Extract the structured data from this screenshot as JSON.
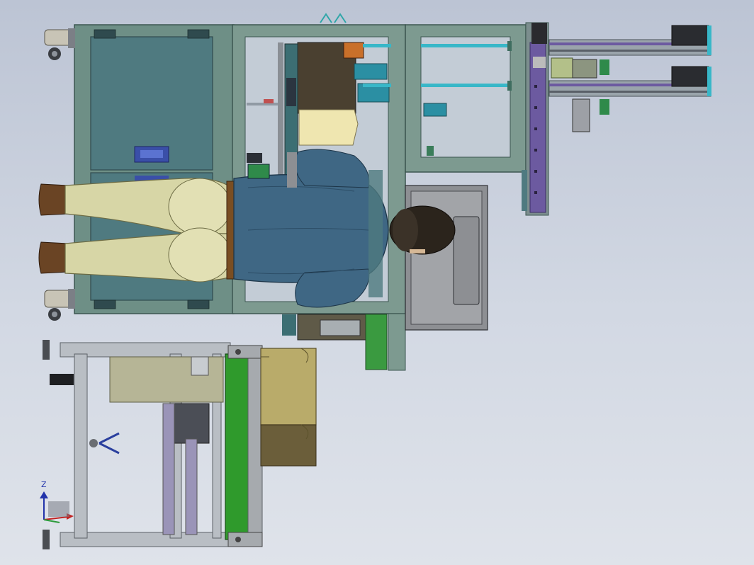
{
  "viewport": {
    "background_top": "#bcc4d4",
    "background_bottom": "#dfe3ea"
  },
  "colors": {
    "frame_teal": "#6e8f86",
    "frame_edge": "#3c5650",
    "panel_teal": "#4f7a80",
    "aluminum": "#b9bec4",
    "conveyor_green": "#2f9a2c",
    "box_tan": "#b9ab6a",
    "shirt_blue": "#3f6784",
    "pants_khaki": "#d7d6a6",
    "hair_dark": "#2b241c",
    "rail_purple": "#6c5aa0",
    "cyan_rod": "#38b7c8",
    "panel_label": "#2a3f9e",
    "machine_gray": "#8d8f93"
  },
  "triad": {
    "axis_label": "Z",
    "icons": [
      "triad-z-arrow-icon",
      "triad-x-arrow-icon",
      "triad-y-arrow-icon"
    ]
  }
}
